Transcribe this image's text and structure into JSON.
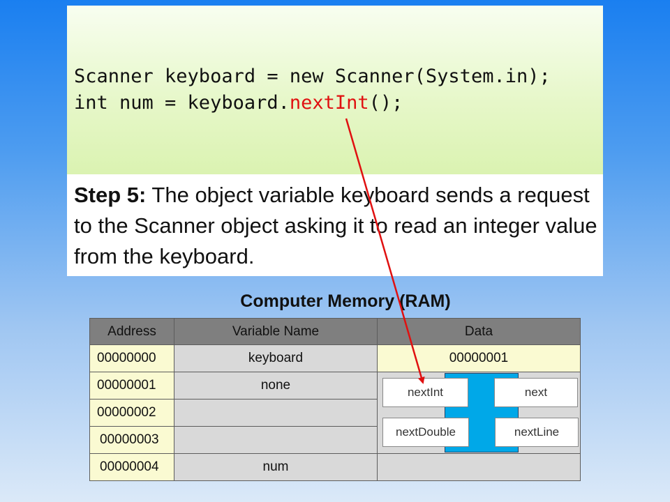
{
  "code": {
    "line1": "Scanner keyboard = new Scanner(System.in);",
    "line2_pre": "int num = keyboard.",
    "line2_red": "nextInt",
    "line2_post": "();"
  },
  "step": {
    "label": "Step 5:",
    "text": " The object variable keyboard sends a request to the Scanner object asking it to read an integer value from the keyboard."
  },
  "memory": {
    "title": "Computer Memory (RAM)",
    "headers": [
      "Address",
      "Variable Name",
      "Data"
    ],
    "rows": [
      {
        "address": "00000000",
        "name": "keyboard",
        "data": "00000001"
      },
      {
        "address": "00000001",
        "name": "none",
        "data": ""
      },
      {
        "address": "00000002",
        "name": "",
        "data": ""
      },
      {
        "address": "00000003",
        "name": "",
        "data": ""
      },
      {
        "address": "00000004",
        "name": "num",
        "data": ""
      }
    ]
  },
  "scanner_methods": [
    "nextInt",
    "next",
    "nextDouble",
    "nextLine"
  ],
  "colors": {
    "arrow": "#e01010",
    "scanner_object": "#00a8e8",
    "highlight": "#fafad2"
  }
}
